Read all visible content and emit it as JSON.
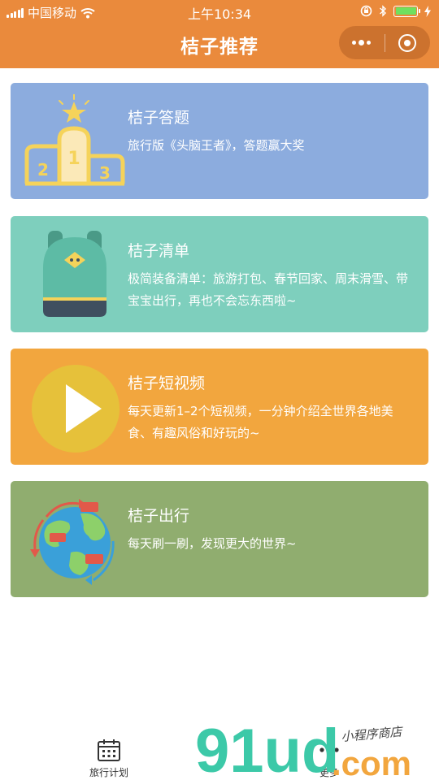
{
  "status_bar": {
    "carrier": "中国移动",
    "time": "上午10:34"
  },
  "navbar": {
    "title": "桔子推荐"
  },
  "cards": [
    {
      "title": "桔子答题",
      "desc": "旅行版《头脑王者》，答题赢大奖",
      "color": "#8cacde",
      "icon": "podium-icon"
    },
    {
      "title": "桔子清单",
      "desc": "极简装备清单：旅游打包、春节回家、周末滑雪、带宝宝出行，再也不会忘东西啦~",
      "color": "#7ecfbd",
      "icon": "backpack-icon"
    },
    {
      "title": "桔子短视频",
      "desc": "每天更新1–2个短视频，一分钟介绍全世界各地美食、有趣风俗和好玩的~",
      "color": "#f2a63e",
      "icon": "play-icon"
    },
    {
      "title": "桔子出行",
      "desc": "每天刷一刷，发现更大的世界~",
      "color": "#90ad6f",
      "icon": "globe-icon"
    }
  ],
  "tabbar": {
    "items": [
      {
        "label": "旅行计划",
        "icon": "calendar-icon"
      },
      {
        "label": "更多",
        "icon": "more-icon"
      }
    ]
  },
  "watermark": {
    "brand": "91ud",
    "domain": ".com",
    "tagline": "小程序商店"
  },
  "colors": {
    "header": "#ea8a3c",
    "card_quiz": "#8cacde",
    "card_list": "#7ecfbd",
    "card_video": "#f2a63e",
    "card_travel": "#90ad6f"
  }
}
